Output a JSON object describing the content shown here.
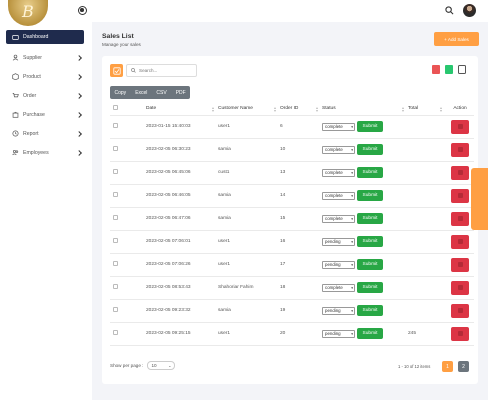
{
  "sidebar": {
    "items": [
      {
        "label": "Dashboard",
        "icon": "dashboard-icon",
        "active": true
      },
      {
        "label": "Supplier",
        "icon": "user-icon"
      },
      {
        "label": "Product",
        "icon": "box-icon"
      },
      {
        "label": "Order",
        "icon": "cart-icon"
      },
      {
        "label": "Purchase",
        "icon": "bag-icon"
      },
      {
        "label": "Report",
        "icon": "clock-icon"
      },
      {
        "label": "Employees",
        "icon": "users-icon"
      }
    ]
  },
  "header": {
    "title": "Sales List",
    "subtitle": "Manage your sales",
    "add_label": "+ Add Sales"
  },
  "search": {
    "placeholder": "Search..."
  },
  "export": {
    "copy": "Copy",
    "excel": "Excel",
    "csv": "CSV",
    "pdf": "PDF"
  },
  "columns": {
    "date": "Date",
    "customer": "Customer Name",
    "order_id": "Order ID",
    "status": "Status",
    "total": "Total",
    "action": "Action"
  },
  "submit_label": "Submit",
  "rows": [
    {
      "date": "2023-01-15 15:40:03",
      "customer": "user1",
      "order_id": "6",
      "status": "complete",
      "total": ""
    },
    {
      "date": "2023-02-05 06:30:23",
      "customer": "samia",
      "order_id": "10",
      "status": "complete",
      "total": ""
    },
    {
      "date": "2023-02-05 06:45:06",
      "customer": "cust1",
      "order_id": "13",
      "status": "complete",
      "total": ""
    },
    {
      "date": "2023-02-05 06:46:05",
      "customer": "samia",
      "order_id": "14",
      "status": "complete",
      "total": ""
    },
    {
      "date": "2023-02-05 06:47:06",
      "customer": "samia",
      "order_id": "15",
      "status": "complete",
      "total": ""
    },
    {
      "date": "2023-02-05 07:06:01",
      "customer": "user1",
      "order_id": "16",
      "status": "pending",
      "total": ""
    },
    {
      "date": "2023-02-05 07:06:26",
      "customer": "user1",
      "order_id": "17",
      "status": "pending",
      "total": ""
    },
    {
      "date": "2023-02-05 08:53:43",
      "customer": "Shahoriar Fahim",
      "order_id": "18",
      "status": "complete",
      "total": ""
    },
    {
      "date": "2023-02-05 09:23:32",
      "customer": "samia",
      "order_id": "19",
      "status": "pending",
      "total": ""
    },
    {
      "date": "2023-02-05 09:25:15",
      "customer": "user1",
      "order_id": "20",
      "status": "pending",
      "total": "245"
    }
  ],
  "footer": {
    "per_page_label": "Show per page :",
    "per_page_value": "10",
    "info": "1 - 10 of 12 items",
    "pages": [
      "1",
      "2"
    ]
  },
  "colors": {
    "accent": "#ff9f43",
    "nav_active": "#1f2b4d",
    "submit": "#28a745",
    "delete": "#dc3545"
  }
}
